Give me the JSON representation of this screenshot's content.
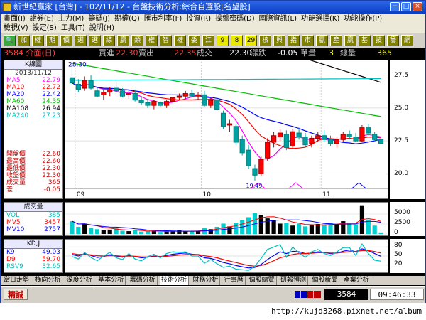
{
  "window": {
    "title": "新世紀贏家 [台灣] - 102/11/12 - 台盤技術分析:綜合自選股[名望股]",
    "controls": [
      "−",
      "□",
      "×"
    ]
  },
  "menu": {
    "row1": [
      "畫面(I)",
      "證券(E)",
      "主力(M)",
      "籌碼(J)",
      "期權(Q)",
      "匯市利率(F)",
      "投資(R)",
      "操盤密碼(D)",
      "國際資訊(L)",
      "功能選擇(K)",
      "功能操作(P)"
    ],
    "row2": [
      "檢視(V)",
      "設定(S)",
      "工具(T)",
      "說明(H)"
    ]
  },
  "toolbar": {
    "buttons": [
      "🔍",
      "加",
      "權",
      "期",
      "價",
      "選",
      "選",
      "綜",
      "贏",
      "類",
      "權",
      "智",
      "權",
      "委",
      "江",
      "9",
      "8",
      "29",
      "核",
      "興",
      "指",
      "市",
      "贏",
      "產",
      "贏",
      "基",
      "技",
      "籌",
      "網"
    ]
  },
  "quote": {
    "code_name": "3584 介面(日)",
    "bid_label": "買進",
    "bid": "22.30",
    "ask_label": "賣出",
    "ask": "22.35",
    "last_label": "成交",
    "last": "22.30",
    "chg_label": "漲跌",
    "chg": "-0.05",
    "vol_label": "單量",
    "vol": "3",
    "total_label": "總量",
    "total": "365"
  },
  "kline": {
    "header": "K線圖",
    "date": "2013/11/12",
    "ma": [
      {
        "name": "MA5",
        "value": "22.79",
        "color": "#ff00ff"
      },
      {
        "name": "MA10",
        "value": "22.72",
        "color": "#ff0000"
      },
      {
        "name": "MA20",
        "value": "22.42",
        "color": "#0000ff"
      },
      {
        "name": "MA60",
        "value": "24.35",
        "color": "#00c000"
      },
      {
        "name": "MA108",
        "value": "26.94",
        "color": "#000000"
      },
      {
        "name": "MA240",
        "value": "27.23",
        "color": "#00c0c0"
      }
    ],
    "ohlc": [
      {
        "name": "開盤價",
        "value": "22.60"
      },
      {
        "name": "最高價",
        "value": "22.60"
      },
      {
        "name": "最低價",
        "value": "22.30"
      },
      {
        "name": "收盤價",
        "value": "22.30"
      },
      {
        "name": "成交量",
        "value": "365"
      },
      {
        "name": "差",
        "value": "-0.05"
      }
    ],
    "hi_label": "28.30",
    "lo_label": "19.49",
    "y_ticks": [
      "27.5",
      "25.0",
      "22.5",
      "20.0"
    ],
    "x_ticks": [
      "09",
      "10",
      "11"
    ]
  },
  "volume": {
    "header": "成交量",
    "rows": [
      {
        "name": "VOL",
        "value": "385",
        "color": "#00c0c0"
      },
      {
        "name": "MV5",
        "value": "3457",
        "color": "#ff0000"
      },
      {
        "name": "MV10",
        "value": "2757",
        "color": "#0000ff"
      }
    ],
    "y_ticks": [
      "5000",
      "2500",
      "0"
    ]
  },
  "kd": {
    "header": "KD,J",
    "rows": [
      {
        "name": "K9",
        "value": "49.03",
        "color": "#0000ff"
      },
      {
        "name": "D9",
        "value": "59.70",
        "color": "#ff0000"
      },
      {
        "name": "RSV9",
        "value": "32.65",
        "color": "#00c0c0"
      }
    ],
    "y_ticks": [
      "80",
      "50",
      "20"
    ]
  },
  "tabs": {
    "items": [
      "當日走勢",
      "橫向分析",
      "深度分析",
      "基本分析",
      "籌碼分析",
      "技術分析",
      "財務分析",
      "行事曆",
      "個股總覽",
      "研報預測",
      "個股新聞",
      "產業分析"
    ],
    "active": "技術分析"
  },
  "status": {
    "button": "精誠",
    "code": "3584",
    "time": "09:46:33"
  },
  "footer": {
    "url": "http://kujd3268.pixnet.net/album"
  },
  "chart_data": [
    {
      "type": "candlestick",
      "title": "K線圖",
      "x_ticks": [
        "09",
        "10",
        "11"
      ],
      "ylim": [
        19.0,
        28.5
      ],
      "y_ticks": [
        20.0,
        22.5,
        25.0,
        27.5
      ],
      "candles": [
        {
          "o": 27.3,
          "h": 28.3,
          "l": 26.8,
          "c": 26.9
        },
        {
          "o": 26.8,
          "h": 27.2,
          "l": 26.2,
          "c": 26.4
        },
        {
          "o": 26.5,
          "h": 27.4,
          "l": 26.3,
          "c": 27.1
        },
        {
          "o": 27.1,
          "h": 27.5,
          "l": 26.4,
          "c": 26.5
        },
        {
          "o": 26.3,
          "h": 26.5,
          "l": 25.8,
          "c": 25.9
        },
        {
          "o": 26.0,
          "h": 26.4,
          "l": 25.6,
          "c": 26.2
        },
        {
          "o": 26.2,
          "h": 26.6,
          "l": 25.9,
          "c": 26.4
        },
        {
          "o": 26.5,
          "h": 27.0,
          "l": 26.2,
          "c": 26.3
        },
        {
          "o": 26.3,
          "h": 26.5,
          "l": 25.8,
          "c": 25.9
        },
        {
          "o": 26.0,
          "h": 26.3,
          "l": 25.7,
          "c": 26.1
        },
        {
          "o": 26.1,
          "h": 26.4,
          "l": 25.5,
          "c": 25.6
        },
        {
          "o": 25.6,
          "h": 25.9,
          "l": 25.2,
          "c": 25.4
        },
        {
          "o": 25.4,
          "h": 25.7,
          "l": 25.0,
          "c": 25.2
        },
        {
          "o": 25.2,
          "h": 25.6,
          "l": 24.9,
          "c": 25.5
        },
        {
          "o": 25.4,
          "h": 25.5,
          "l": 25.1,
          "c": 25.2
        },
        {
          "o": 25.2,
          "h": 25.6,
          "l": 25.0,
          "c": 25.5
        },
        {
          "o": 25.5,
          "h": 25.9,
          "l": 25.3,
          "c": 25.8
        },
        {
          "o": 25.8,
          "h": 26.1,
          "l": 25.6,
          "c": 25.9
        },
        {
          "o": 25.9,
          "h": 26.3,
          "l": 25.7,
          "c": 26.1
        },
        {
          "o": 26.1,
          "h": 26.4,
          "l": 25.8,
          "c": 25.9
        },
        {
          "o": 25.9,
          "h": 26.2,
          "l": 25.6,
          "c": 26.0
        },
        {
          "o": 26.0,
          "h": 26.3,
          "l": 25.1,
          "c": 25.2
        },
        {
          "o": 25.2,
          "h": 25.8,
          "l": 25.0,
          "c": 25.6
        },
        {
          "o": 25.6,
          "h": 25.8,
          "l": 24.8,
          "c": 24.9
        },
        {
          "o": 24.6,
          "h": 24.8,
          "l": 23.4,
          "c": 23.6
        },
        {
          "o": 23.7,
          "h": 24.1,
          "l": 23.2,
          "c": 23.8
        },
        {
          "o": 23.6,
          "h": 23.8,
          "l": 22.2,
          "c": 22.4
        },
        {
          "o": 22.6,
          "h": 22.9,
          "l": 21.4,
          "c": 21.6
        },
        {
          "o": 21.8,
          "h": 22.2,
          "l": 20.4,
          "c": 20.6
        },
        {
          "o": 20.4,
          "h": 20.7,
          "l": 19.49,
          "c": 19.9
        },
        {
          "o": 20.0,
          "h": 21.3,
          "l": 19.8,
          "c": 21.1
        },
        {
          "o": 21.2,
          "h": 22.7,
          "l": 21.0,
          "c": 22.4
        },
        {
          "o": 22.4,
          "h": 23.2,
          "l": 22.0,
          "c": 22.9
        },
        {
          "o": 22.8,
          "h": 23.4,
          "l": 22.5,
          "c": 23.1
        },
        {
          "o": 23.0,
          "h": 23.3,
          "l": 21.8,
          "c": 22.0
        },
        {
          "o": 22.1,
          "h": 23.4,
          "l": 21.9,
          "c": 23.2
        },
        {
          "o": 23.1,
          "h": 23.5,
          "l": 22.6,
          "c": 22.8
        },
        {
          "o": 22.8,
          "h": 23.1,
          "l": 22.0,
          "c": 22.2
        },
        {
          "o": 22.3,
          "h": 22.9,
          "l": 22.0,
          "c": 22.7
        },
        {
          "o": 22.7,
          "h": 23.2,
          "l": 22.4,
          "c": 22.9
        },
        {
          "o": 22.9,
          "h": 23.3,
          "l": 22.4,
          "c": 22.6
        },
        {
          "o": 22.6,
          "h": 22.9,
          "l": 22.1,
          "c": 22.3
        },
        {
          "o": 22.3,
          "h": 22.8,
          "l": 22.0,
          "c": 22.6
        },
        {
          "o": 22.6,
          "h": 23.2,
          "l": 22.4,
          "c": 23.0
        },
        {
          "o": 23.0,
          "h": 23.3,
          "l": 22.6,
          "c": 22.8
        },
        {
          "o": 22.8,
          "h": 23.1,
          "l": 22.4,
          "c": 22.5
        },
        {
          "o": 22.5,
          "h": 23.7,
          "l": 22.4,
          "c": 23.5
        },
        {
          "o": 23.5,
          "h": 23.8,
          "l": 22.9,
          "c": 23.1
        },
        {
          "o": 23.0,
          "h": 23.2,
          "l": 22.4,
          "c": 22.6
        },
        {
          "o": 22.6,
          "h": 22.6,
          "l": 22.3,
          "c": 22.3
        }
      ],
      "ma_series": [
        {
          "name": "MA5",
          "color": "#ff00ff"
        },
        {
          "name": "MA10",
          "color": "#ff0000"
        },
        {
          "name": "MA20",
          "color": "#0000ff"
        },
        {
          "name": "MA60",
          "color": "#00c000",
          "start": 28.4,
          "end": 24.35
        },
        {
          "name": "MA108",
          "color": "#000000",
          "start": 29.2,
          "end": 26.94,
          "begin_index": 34
        },
        {
          "name": "MA240",
          "color": "#00c0c0",
          "start": 27.1,
          "end": 27.23
        }
      ]
    },
    {
      "type": "bar",
      "title": "成交量",
      "ylim": [
        0,
        7500
      ],
      "y_ticks": [
        0,
        2500,
        5000
      ],
      "values": [
        3200,
        1800,
        2600,
        1500,
        1200,
        900,
        1100,
        1400,
        800,
        700,
        900,
        600,
        700,
        800,
        500,
        600,
        700,
        900,
        650,
        700,
        800,
        1500,
        1200,
        1800,
        2600,
        1900,
        2800,
        3400,
        4200,
        5200,
        4800,
        3900,
        3500,
        2600,
        2800,
        2100,
        2600,
        1900,
        2200,
        2500,
        2300,
        2800,
        2500,
        3200,
        2800,
        2400,
        7200,
        3600,
        2100,
        385
      ],
      "up": [
        false,
        false,
        true,
        false,
        false,
        true,
        true,
        false,
        false,
        true,
        false,
        false,
        false,
        true,
        false,
        true,
        true,
        true,
        true,
        false,
        true,
        false,
        true,
        false,
        false,
        true,
        false,
        false,
        false,
        false,
        true,
        true,
        true,
        true,
        false,
        true,
        false,
        false,
        true,
        true,
        false,
        false,
        true,
        true,
        false,
        false,
        true,
        false,
        false,
        false
      ]
    },
    {
      "type": "line",
      "title": "KD,J",
      "ylim": [
        0,
        100
      ],
      "y_ticks": [
        20,
        50,
        80
      ],
      "series": [
        {
          "name": "K9",
          "color": "#0000ff",
          "values": [
            55,
            50,
            58,
            52,
            45,
            48,
            54,
            50,
            46,
            52,
            48,
            44,
            46,
            50,
            48,
            52,
            56,
            58,
            60,
            56,
            54,
            44,
            42,
            36,
            28,
            24,
            18,
            14,
            10,
            12,
            22,
            38,
            52,
            64,
            58,
            66,
            64,
            58,
            60,
            64,
            62,
            58,
            60,
            66,
            70,
            64,
            74,
            68,
            58,
            49.03
          ]
        },
        {
          "name": "D9",
          "color": "#ff0000",
          "values": [
            58,
            55,
            56,
            54,
            51,
            50,
            51,
            51,
            49,
            50,
            49,
            47,
            47,
            48,
            48,
            49,
            51,
            53,
            55,
            55,
            55,
            51,
            48,
            44,
            38,
            33,
            28,
            23,
            18,
            16,
            18,
            25,
            34,
            44,
            49,
            55,
            58,
            58,
            59,
            61,
            61,
            60,
            60,
            62,
            65,
            65,
            68,
            68,
            65,
            59.7
          ]
        },
        {
          "name": "RSV9",
          "color": "#00c0c0",
          "values": [
            48,
            40,
            62,
            45,
            34,
            50,
            62,
            44,
            38,
            58,
            40,
            34,
            48,
            56,
            44,
            58,
            64,
            62,
            64,
            50,
            50,
            26,
            38,
            24,
            12,
            16,
            6,
            4,
            2,
            16,
            42,
            72,
            80,
            88,
            46,
            80,
            60,
            46,
            64,
            72,
            58,
            52,
            64,
            78,
            78,
            52,
            90,
            58,
            36,
            32.65
          ]
        }
      ]
    }
  ]
}
